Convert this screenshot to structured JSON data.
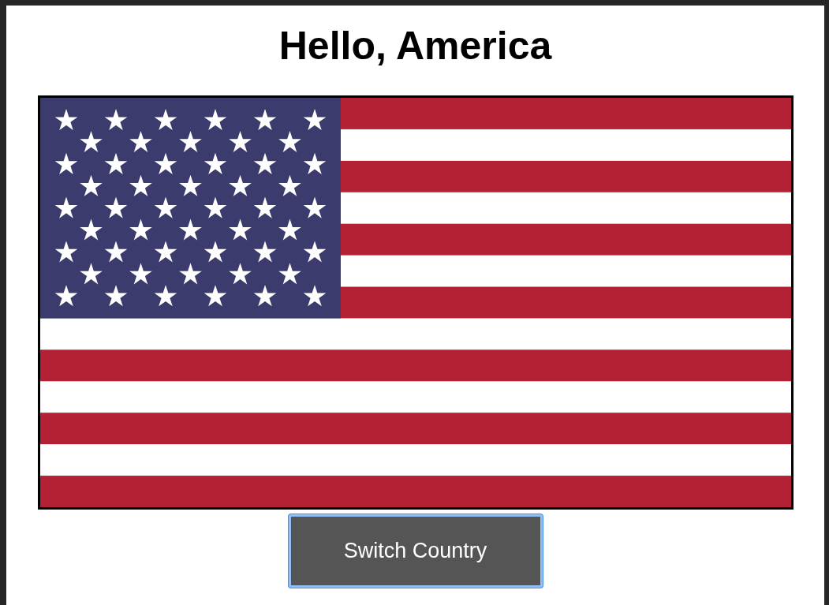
{
  "heading": "Hello, America",
  "button": {
    "label": "Switch Country",
    "focused": true
  }
}
